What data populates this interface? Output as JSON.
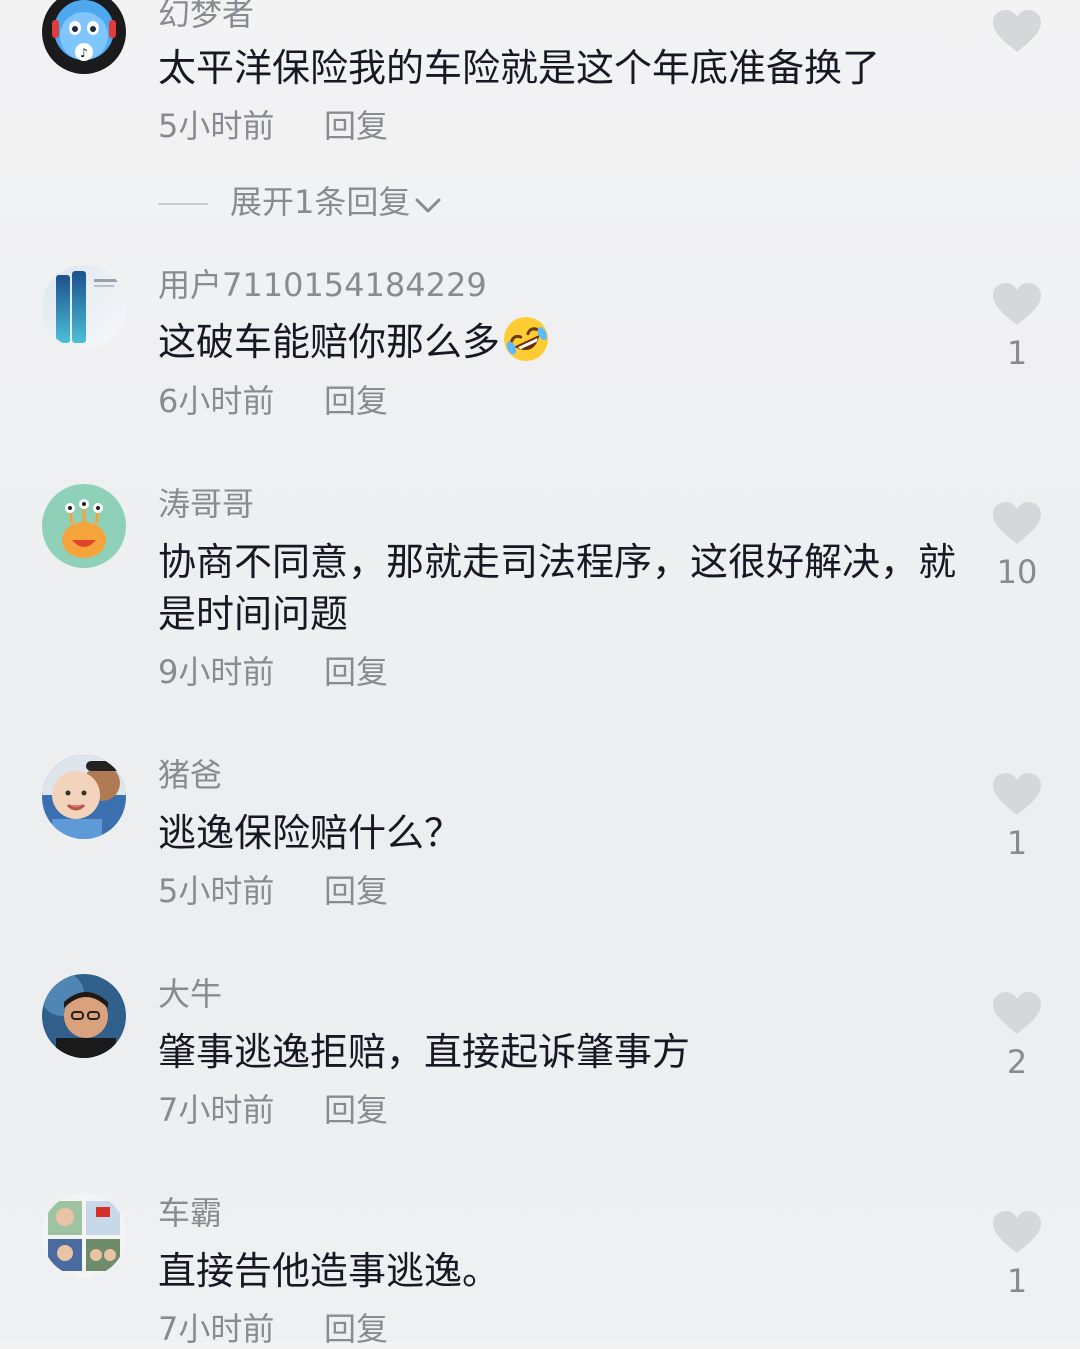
{
  "comments": [
    {
      "username": "幻梦者",
      "text": "太平洋保险我的车险就是这个年底准备换了",
      "time": "5小时前",
      "reply_label": "回复",
      "likes": "",
      "avatar": "blue-robot-avatar"
    },
    {
      "username": "用户7110154184229",
      "text": "这破车能赔你那么多",
      "emoji": "rofl-emoji",
      "time": "6小时前",
      "reply_label": "回复",
      "likes": "1",
      "avatar": "phone-avatar"
    },
    {
      "username": "涛哥哥",
      "text": "协商不同意，那就走司法程序，这很好解决，就是时间问题",
      "time": "9小时前",
      "reply_label": "回复",
      "likes": "10",
      "avatar": "monster-avatar"
    },
    {
      "username": "猪爸",
      "text": "逃逸保险赔什么？",
      "time": "5小时前",
      "reply_label": "回复",
      "likes": "1",
      "avatar": "baby-photo-avatar"
    },
    {
      "username": "大牛",
      "text": "肇事逃逸拒赔，直接起诉肇事方",
      "time": "7小时前",
      "reply_label": "回复",
      "likes": "2",
      "avatar": "man-photo-avatar"
    },
    {
      "username": "车霸",
      "text": "直接告他造事逃逸。",
      "time": "7小时前",
      "reply_label": "回复",
      "likes": "1",
      "avatar": "collage-avatar"
    }
  ],
  "expand_replies": {
    "label": "展开1条回复"
  },
  "colors": {
    "background": "#efeff1",
    "text_primary": "#161823",
    "text_secondary": "#8a8b90",
    "heart": "#d6d7da"
  },
  "icons": {
    "like": "heart-icon",
    "expand": "chevron-down-icon"
  }
}
